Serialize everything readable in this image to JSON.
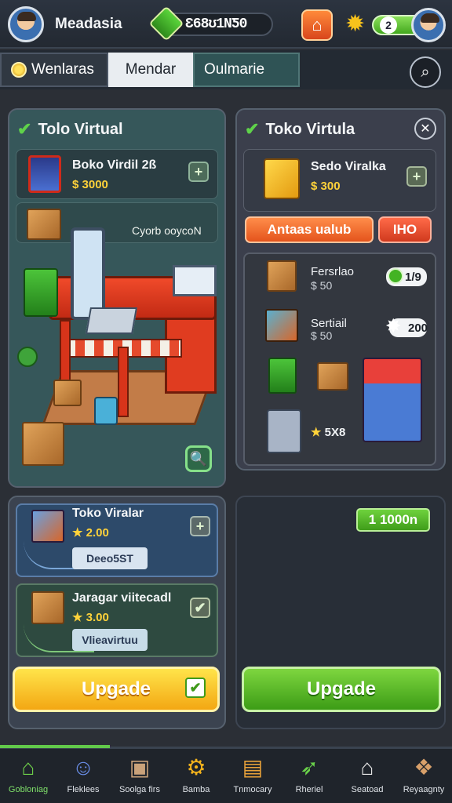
{
  "header": {
    "username": "Meadasia",
    "currency_value": "Ɛ68ʊ1NƼ0",
    "energy_value": "2"
  },
  "tabs": [
    {
      "label": "Wenlaras"
    },
    {
      "label": "Mendar"
    },
    {
      "label": "Oulmarie"
    }
  ],
  "left_panel": {
    "title": "Tolo Virtual",
    "item": {
      "name": "Boko Virdil 2ß",
      "price": "$ 3000"
    },
    "tag_text": "Cyorb ooycoN"
  },
  "right_panel": {
    "title": "Toko Virtula",
    "item": {
      "name": "Sedo Viralka",
      "price": "$ 300"
    },
    "action_primary": "Antaas ualub",
    "action_secondary": "IHO",
    "list": [
      {
        "name": "Fersrlao",
        "price": "$ 50",
        "badge": "1/9"
      },
      {
        "name": "Sertiail",
        "price": "$ 50",
        "badge": "200"
      }
    ],
    "star_price": "5X8"
  },
  "bottom_left": {
    "card1": {
      "name": "Toko Viralar",
      "price": "2.00",
      "button": "Deeo5ST"
    },
    "card2": {
      "name": "Jaragar viitecadl",
      "price": "3.00",
      "button": "Vlieavirtuu"
    },
    "upgrade_label": "Upgade"
  },
  "bottom_right": {
    "pill_label": "1 1000n",
    "upgrade_label": "Upgade"
  },
  "nav": [
    {
      "label": "Gobloniag",
      "icon": "home-icon"
    },
    {
      "label": "Fleklees",
      "icon": "smile-icon"
    },
    {
      "label": "Soolga firs",
      "icon": "box-icon"
    },
    {
      "label": "Bamba",
      "icon": "gear-icon"
    },
    {
      "label": "Tnmocary",
      "icon": "chest-icon"
    },
    {
      "label": "Rheriel",
      "icon": "rocket-icon"
    },
    {
      "label": "Seatoad",
      "icon": "shop-icon"
    },
    {
      "label": "Reyaagnty",
      "icon": "leaf-box-icon"
    }
  ],
  "colors": {
    "accent_green": "#62c94a",
    "accent_yellow": "#f3a713",
    "accent_orange": "#e4541c"
  }
}
